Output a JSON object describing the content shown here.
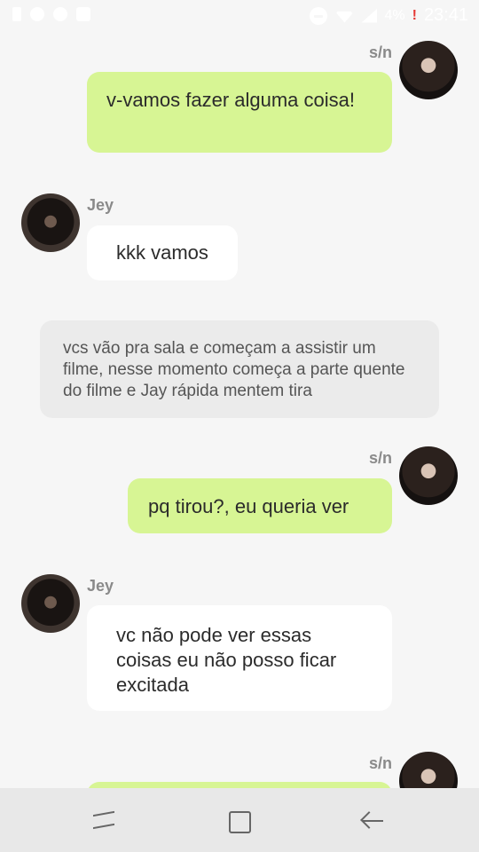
{
  "status_bar": {
    "battery_percent": "4%",
    "alert": "!",
    "time": "23:41"
  },
  "messages": [
    {
      "kind": "me",
      "sender": "s/n",
      "text": "v-vamos fazer alguma coisa!"
    },
    {
      "kind": "them",
      "sender": "Jey",
      "text": "kkk vamos"
    },
    {
      "kind": "narration",
      "text": "vcs vão pra sala e começam a assistir um filme, nesse momento começa a parte quente do filme e Jay rápida mentem tira"
    },
    {
      "kind": "me",
      "sender": "s/n",
      "text": "pq tirou?, eu queria ver"
    },
    {
      "kind": "them",
      "sender": "Jey",
      "text": "vc não pode ver essas coisas eu não posso ficar excitada"
    },
    {
      "kind": "me",
      "sender": "s/n",
      "text": ""
    }
  ],
  "colors": {
    "background": "#f6f6f6",
    "my_bubble": "#d7f594",
    "their_bubble": "#ffffff",
    "narration_bubble": "#ebebeb"
  },
  "nav_bar": {
    "icons": [
      "recents-icon",
      "home-icon",
      "back-icon"
    ]
  }
}
